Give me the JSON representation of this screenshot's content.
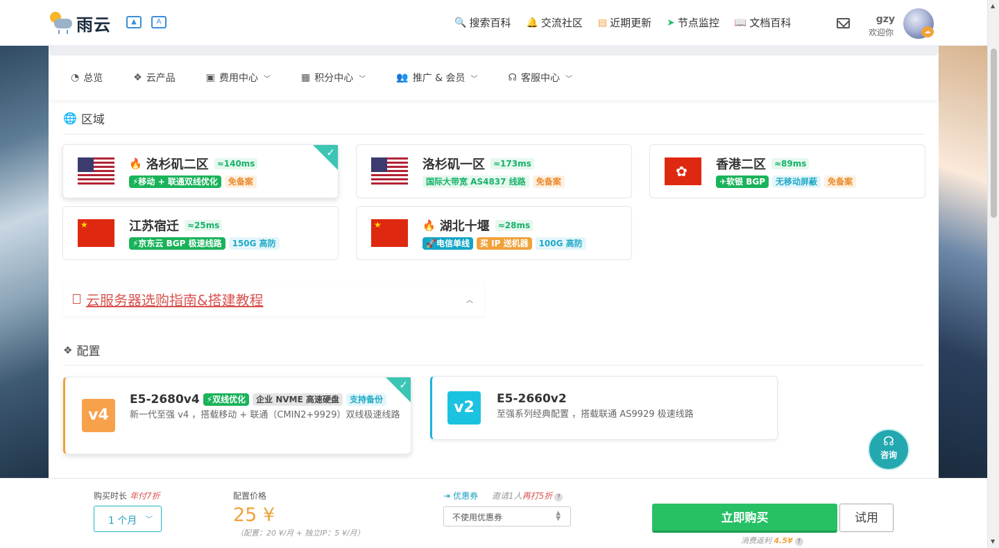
{
  "header": {
    "logo_text": "雨云",
    "nav": [
      {
        "icon": "search-icon",
        "glyph": "🔍",
        "label": "搜索百科"
      },
      {
        "icon": "bell-icon",
        "glyph": "🔔",
        "label": "交流社区"
      },
      {
        "icon": "news-icon",
        "glyph": "▤",
        "label": "近期更新"
      },
      {
        "icon": "send-icon",
        "glyph": "➤",
        "label": "节点监控"
      },
      {
        "icon": "book-icon",
        "glyph": "📖",
        "label": "文档百科"
      }
    ],
    "user_name": "gzy",
    "user_greeting": "欢迎你"
  },
  "subnav": [
    {
      "icon": "dashboard-icon",
      "glyph": "◔",
      "label": "总览",
      "dropdown": false
    },
    {
      "icon": "cubes-icon",
      "glyph": "❖",
      "label": "云产品",
      "dropdown": false
    },
    {
      "icon": "money-icon",
      "glyph": "▣",
      "label": "费用中心",
      "dropdown": true
    },
    {
      "icon": "gift-icon",
      "glyph": "▦",
      "label": "积分中心",
      "dropdown": true
    },
    {
      "icon": "users-icon",
      "glyph": "👥",
      "label": "推广 & 会员",
      "dropdown": true
    },
    {
      "icon": "headset-icon",
      "glyph": "☊",
      "label": "客服中心",
      "dropdown": true
    }
  ],
  "region_section": {
    "title": "区域"
  },
  "regions": [
    {
      "name": "洛杉矶二区",
      "latency": "≈140ms",
      "flag": "us",
      "hot": true,
      "selected": true,
      "tags": [
        {
          "text": "⚡移动 + 联通双线优化",
          "style": "t-green"
        },
        {
          "text": "免备案",
          "style": "t-orange-l"
        }
      ]
    },
    {
      "name": "洛杉矶一区",
      "latency": "≈173ms",
      "flag": "us",
      "hot": false,
      "selected": false,
      "tags": [
        {
          "text": "国际大带宽 AS4837 线路",
          "style": "t-green-l"
        },
        {
          "text": "免备案",
          "style": "t-orange-l"
        }
      ]
    },
    {
      "name": "香港二区",
      "latency": "≈89ms",
      "flag": "hk",
      "hot": false,
      "selected": false,
      "tags": [
        {
          "text": "✈软银 BGP",
          "style": "t-green"
        },
        {
          "text": "无移动屏蔽",
          "style": "t-cyan-l"
        },
        {
          "text": "免备案",
          "style": "t-orange-l"
        }
      ]
    },
    {
      "name": "江苏宿迁",
      "latency": "≈25ms",
      "flag": "cn",
      "hot": false,
      "selected": false,
      "tags": [
        {
          "text": "⚡京东云 BGP 极速线路",
          "style": "t-green"
        },
        {
          "text": "150G 高防",
          "style": "t-cyan-l"
        }
      ]
    },
    {
      "name": "湖北十堰",
      "latency": "≈28ms",
      "flag": "cn",
      "hot": true,
      "selected": false,
      "tags": [
        {
          "text": "🚀电信单线",
          "style": "t-cyan"
        },
        {
          "text": "买 IP 送机器",
          "style": "t-orange"
        },
        {
          "text": "100G 高防",
          "style": "t-cyan-l"
        }
      ]
    }
  ],
  "guide": {
    "title": "云服务器选购指南&搭建教程"
  },
  "config_section": {
    "title": "配置"
  },
  "configs": [
    {
      "badge": "v4",
      "badge_color": "#f7a14b",
      "name": "E5-2680v4",
      "selected": true,
      "tags": [
        {
          "text": "⚡双线优化",
          "style": "t-green"
        },
        {
          "text": "企业 NVME 高速硬盘",
          "style": "t-gray"
        },
        {
          "text": "支持备份",
          "style": "t-cyan-l"
        }
      ],
      "desc": "新一代至强 v4 ，搭载移动 + 联通（CMIN2+9929）双线极速线路"
    },
    {
      "badge": "v2",
      "badge_color": "#1bc3e0",
      "name": "E5-2660v2",
      "selected": false,
      "tags": [],
      "desc": "至强系列经典配置 ，搭载联通 AS9929 极速线路"
    }
  ],
  "consult": {
    "label": "咨询"
  },
  "bottom": {
    "duration_label": "购买时长",
    "duration_promo": "年付7折",
    "duration_value": "1 个月",
    "price_label": "配置价格",
    "price": "25 ¥",
    "price_note": "（配置：20 ¥/月 + 独立IP：5 ¥/月）",
    "coupon_label": "优惠券",
    "invite_pre": "邀请1人",
    "invite_red": "再打5折",
    "coupon_value": "不使用优惠券",
    "buy_label": "立即购买",
    "try_label": "试用",
    "rebate_pre": "消费返利",
    "rebate_amt": "4.5¥"
  },
  "colors": {
    "accent": "#27c065",
    "price": "#f0a23a",
    "link": "#d9534f",
    "teal": "#24a8b0"
  }
}
